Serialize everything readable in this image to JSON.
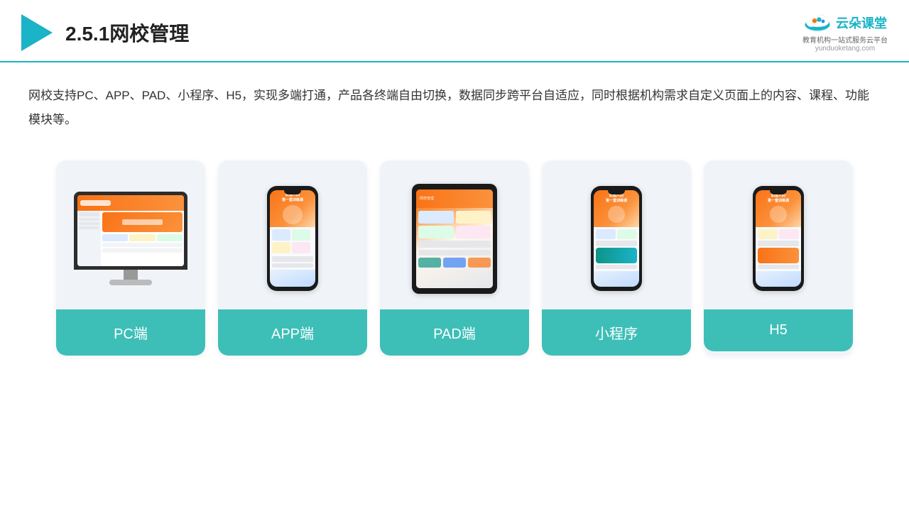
{
  "header": {
    "title": "2.5.1网校管理",
    "brand": {
      "name_cn": "云朵课堂",
      "tagline": "教育机构一站式服务云平台",
      "url": "yunduoketang.com"
    }
  },
  "description": "网校支持PC、APP、PAD、小程序、H5，实现多端打通，产品各终端自由切换，数据同步跨平台自适应，同时根据机构需求自定义页面上的内容、课程、功能模块等。",
  "cards": [
    {
      "id": "pc",
      "label": "PC端",
      "type": "pc"
    },
    {
      "id": "app",
      "label": "APP端",
      "type": "phone"
    },
    {
      "id": "pad",
      "label": "PAD端",
      "type": "tablet"
    },
    {
      "id": "miniapp",
      "label": "小程序",
      "type": "phone2"
    },
    {
      "id": "h5",
      "label": "H5",
      "type": "phone3"
    }
  ],
  "colors": {
    "accent": "#1ab3c8",
    "card_label_bg": "#3dbfb8",
    "header_border": "#1ab3c8"
  }
}
